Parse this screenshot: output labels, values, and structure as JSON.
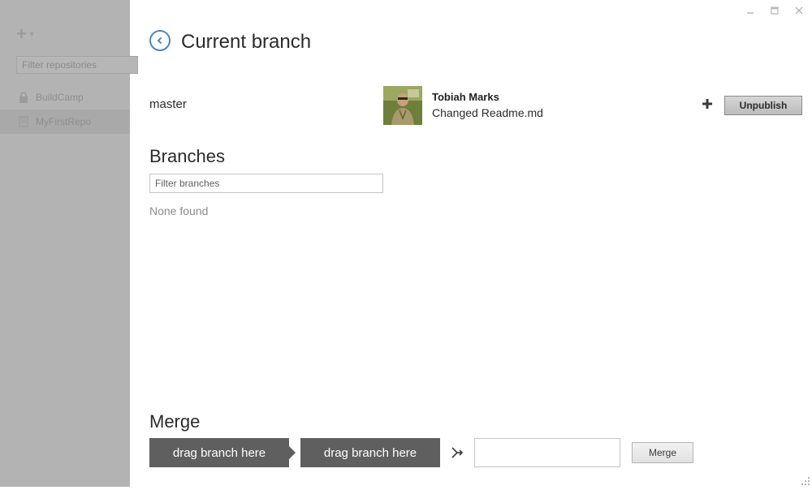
{
  "sidebar": {
    "filter_placeholder": "Filter repositories",
    "repositories": [
      {
        "name": "BuildCamp",
        "icon": "lock-icon"
      },
      {
        "name": "MyFirstRepo",
        "icon": "repo-icon"
      }
    ]
  },
  "header": {
    "title": "Current branch"
  },
  "current_branch": {
    "name": "master",
    "last_commit": {
      "author": "Tobiah Marks",
      "message": "Changed Readme.md"
    },
    "unpublish_label": "Unpublish"
  },
  "branches": {
    "title": "Branches",
    "filter_placeholder": "Filter branches",
    "empty_text": "None found"
  },
  "merge": {
    "title": "Merge",
    "drop_zone_1": "drag branch here",
    "drop_zone_2": "drag branch here",
    "button_label": "Merge"
  },
  "colors": {
    "accent": "#4a87c4",
    "drop_zone": "#5f5f5f",
    "sidebar_overlay": "#b3b3b3"
  }
}
